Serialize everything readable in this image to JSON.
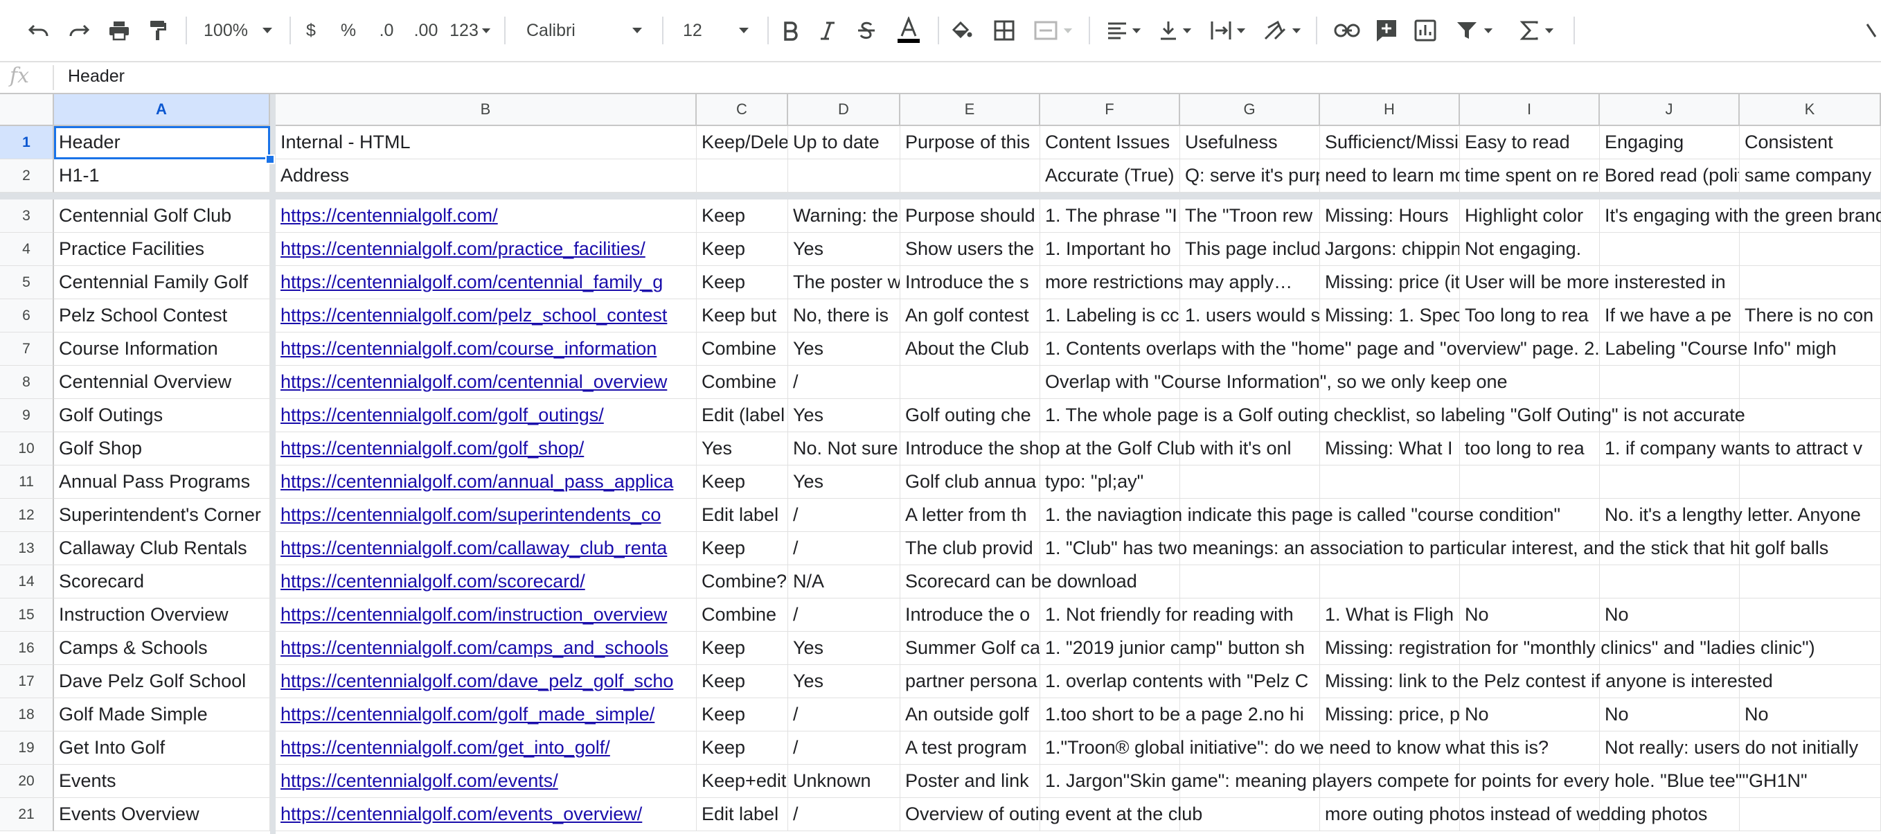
{
  "toolbar": {
    "zoom": "100%",
    "currency": "$",
    "percent": "%",
    "dec_decrease": ".0",
    "dec_increase": ".00",
    "more_formats": "123",
    "font": "Calibri",
    "font_size": "12"
  },
  "formula_bar": {
    "fx": "fx",
    "value": "Header"
  },
  "columns": [
    "A",
    "B",
    "C",
    "D",
    "E",
    "F",
    "G",
    "H",
    "I",
    "J",
    "K"
  ],
  "rows": [
    {
      "n": "1",
      "cells": [
        "Header",
        "Internal - HTML",
        "Keep/Delete",
        "Up to date",
        "Purpose of this",
        "Content Issues",
        "Usefulness",
        "Sufficienct/Missing",
        "Easy to read",
        "Engaging",
        "Consistent"
      ]
    },
    {
      "n": "2",
      "cells": [
        "H1-1",
        "Address",
        "",
        "",
        "",
        "Accurate (True)",
        "Q: serve it's purpose",
        "need to learn more",
        "time spent on reading",
        "Bored read (polite)",
        "same company"
      ]
    },
    {
      "n": "3",
      "cells": [
        "Centennial Golf Club",
        "https://centennialgolf.com/",
        "Keep",
        "Warning: the",
        "Purpose should",
        "1. The phrase \"I",
        "The \"Troon rew",
        "Missing: Hours",
        "Highlight color",
        "It's engaging with the green brand",
        ""
      ]
    },
    {
      "n": "4",
      "cells": [
        "Practice Facilities",
        "https://centennialgolf.com/practice_facilities/",
        "Keep",
        "Yes",
        "Show users the",
        "1. Important ho",
        "This page includ",
        "Jargons: chipping, bunker; Wha",
        "Not engaging.",
        "",
        ""
      ]
    },
    {
      "n": "5",
      "cells": [
        "Centennial Family Golf",
        "https://centennialgolf.com/centennial_family_g",
        "Keep",
        "The poster w",
        "Introduce the s",
        "more restrictions may apply…",
        "",
        "Missing: price (it's hiding in \"lea",
        "User will be more insterested in",
        "",
        ""
      ]
    },
    {
      "n": "6",
      "cells": [
        "Pelz School Contest",
        "https://centennialgolf.com/pelz_school_contest",
        "Keep but",
        "No, there is",
        "An golf contest",
        "1. Labeling is cc",
        "1. users would s",
        "Missing: 1. Spec",
        "Too long to rea",
        "If we have a pe",
        "There is no con"
      ]
    },
    {
      "n": "7",
      "cells": [
        "Course Information",
        "https://centennialgolf.com/course_information",
        "Combine",
        "Yes",
        "About the Club",
        "1. Contents overlaps with the \"home\" page and \"overview\" page. 2. Labeling \"Course Info\" migh",
        "",
        "",
        "",
        "",
        ""
      ]
    },
    {
      "n": "8",
      "cells": [
        "Centennial Overview",
        "https://centennialgolf.com/centennial_overview",
        "Combine",
        "/",
        "",
        "Overlap with \"Course Information\", so we only keep one",
        "",
        "",
        "",
        "",
        ""
      ]
    },
    {
      "n": "9",
      "cells": [
        "Golf Outings",
        "https://centennialgolf.com/golf_outings/",
        "Edit (label",
        "Yes",
        "Golf outing che",
        "1. The whole page is a Golf outing checklist, so labeling \"Golf Outing\" is not accurate",
        "",
        "",
        "",
        "",
        ""
      ]
    },
    {
      "n": "10",
      "cells": [
        "Golf Shop",
        "https://centennialgolf.com/golf_shop/",
        "Yes",
        "No. Not sure",
        "Introduce the shop at the Golf Club with it's onl",
        "",
        "",
        "Missing: What I",
        "too long to rea",
        "1. if company wants to attract v",
        ""
      ]
    },
    {
      "n": "11",
      "cells": [
        "Annual Pass Programs",
        "https://centennialgolf.com/annual_pass_applica",
        "Keep",
        "Yes",
        "Golf club annua",
        "typo: \"pl;ay\"",
        "",
        "",
        "",
        "",
        ""
      ]
    },
    {
      "n": "12",
      "cells": [
        "Superintendent's Corner",
        "https://centennialgolf.com/superintendents_co",
        "Edit label",
        "/",
        "A letter from th",
        "1. the naviagtion indicate this page is called \"course condition\"",
        "",
        "",
        "",
        "No. it's a lengthy letter. Anyone",
        ""
      ]
    },
    {
      "n": "13",
      "cells": [
        "Callaway Club Rentals",
        "https://centennialgolf.com/callaway_club_renta",
        "Keep",
        "/",
        "The club provid",
        "1. \"Club\" has two meanings: an association to particular interest, and the stick that hit golf balls",
        "",
        "",
        "",
        "",
        ""
      ]
    },
    {
      "n": "14",
      "cells": [
        "Scorecard",
        "https://centennialgolf.com/scorecard/",
        "Combine?",
        "N/A",
        "Scorecard can be download",
        "",
        "",
        "",
        "",
        "",
        ""
      ]
    },
    {
      "n": "15",
      "cells": [
        "Instruction Overview",
        "https://centennialgolf.com/instruction_overview",
        "Combine",
        "/",
        "Introduce the o",
        "1. Not friendly for reading with",
        "",
        "1. What is Fligh",
        "No",
        "No",
        ""
      ]
    },
    {
      "n": "16",
      "cells": [
        "Camps & Schools",
        "https://centennialgolf.com/camps_and_schools",
        "Keep",
        "Yes",
        "Summer Golf ca",
        "1. \"2019 junior camp\" button sh",
        "",
        "Missing: registration for \"monthly clinics\" and \"ladies clinic\")",
        "",
        "",
        ""
      ]
    },
    {
      "n": "17",
      "cells": [
        "Dave Pelz Golf School",
        "https://centennialgolf.com/dave_pelz_golf_scho",
        "Keep",
        "Yes",
        "partner persona",
        "1. overlap contents with \"Pelz C",
        "",
        "Missing: link to the Pelz contest if anyone is interested",
        "",
        "",
        ""
      ]
    },
    {
      "n": "18",
      "cells": [
        "Golf Made Simple",
        "https://centennialgolf.com/golf_made_simple/",
        "Keep",
        "/",
        "An outside golf",
        "1.too short to be a page 2.no hi",
        "",
        "Missing: price, p",
        "No",
        "No",
        "No"
      ]
    },
    {
      "n": "19",
      "cells": [
        "Get Into Golf",
        "https://centennialgolf.com/get_into_golf/",
        "Keep",
        "/",
        "A test program",
        "1.\"Troon® global initiative\": do we need to know what this is?",
        "",
        "",
        "",
        "Not really: users do not initially",
        ""
      ]
    },
    {
      "n": "20",
      "cells": [
        "Events",
        "https://centennialgolf.com/events/",
        "Keep+edit",
        "Unknown",
        "Poster and link",
        "1. Jargon\"Skin game\": meaning players compete for points for every hole. \"Blue tee\"\"GH1N\"",
        "",
        "",
        "",
        "",
        ""
      ]
    },
    {
      "n": "21",
      "cells": [
        "Events Overview",
        "https://centennialgolf.com/events_overview/",
        "Edit label",
        "/",
        "Overview of outing event at the club",
        "",
        "",
        "more outing photos instead of wedding photos",
        "",
        "",
        ""
      ]
    }
  ],
  "colors": {
    "accent": "#1a73e8",
    "link": "#1a0dab",
    "header_bg": "#f8f9fa"
  }
}
